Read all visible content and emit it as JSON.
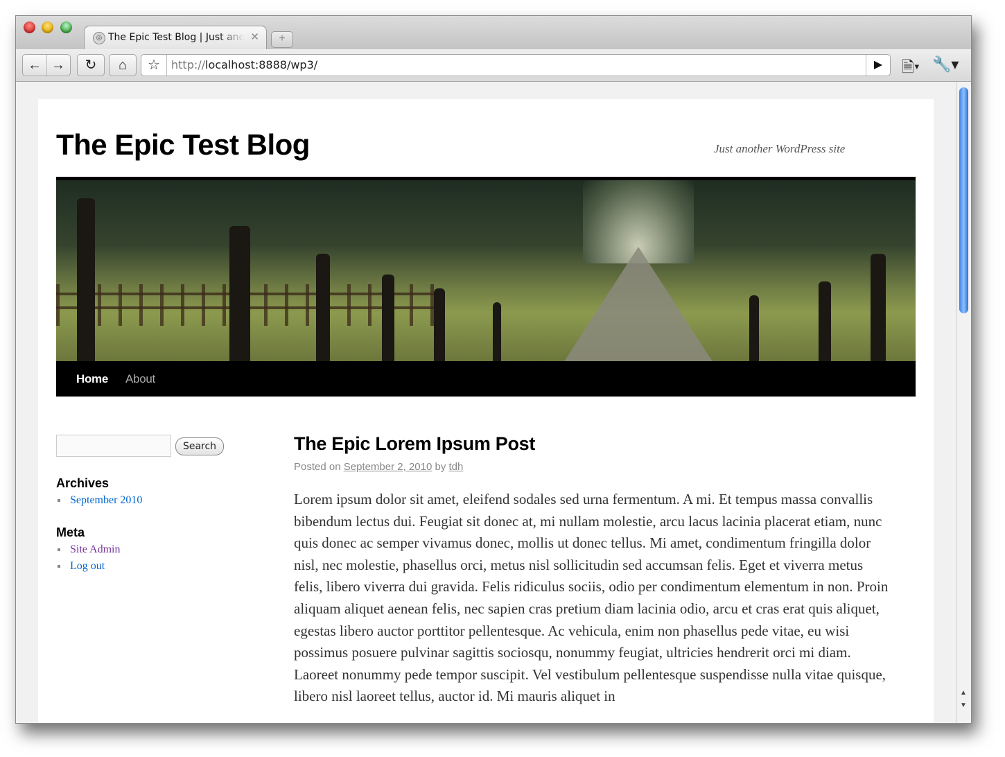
{
  "browser": {
    "tab_title": "The Epic Test Blog | Just another WordPress site",
    "tab_close": "✕",
    "new_tab": "+",
    "url_scheme": "http://",
    "url_rest": "localhost:8888/wp3/",
    "icons": {
      "back": "back-arrow-icon",
      "forward": "forward-arrow-icon",
      "reload": "reload-icon",
      "home": "home-icon",
      "bookmark": "star-icon",
      "go": "play-icon",
      "page": "page-menu-icon",
      "wrench": "wrench-icon"
    }
  },
  "site": {
    "title": "The Epic Test Blog",
    "tagline": "Just another WordPress site"
  },
  "nav": {
    "home": "Home",
    "about": "About"
  },
  "sidebar": {
    "search_button": "Search",
    "search_value": "",
    "archives_title": "Archives",
    "archives": [
      "September 2010"
    ],
    "meta_title": "Meta",
    "meta": [
      "Site Admin",
      "Log out"
    ]
  },
  "post": {
    "title": "The Epic Lorem Ipsum Post",
    "posted_on": "Posted on",
    "date": "September 2, 2010",
    "by": "by",
    "author": "tdh",
    "body": "Lorem ipsum dolor sit amet, eleifend sodales sed urna fermentum. A mi. Et tempus massa convallis bibendum lectus dui. Feugiat sit donec at, mi nullam molestie, arcu lacus lacinia placerat etiam, nunc quis donec ac semper vivamus donec, mollis ut donec tellus. Mi amet, condimentum fringilla dolor nisl, nec molestie, phasellus orci, metus nisl sollicitudin sed accumsan felis. Eget et viverra metus felis, libero viverra dui gravida. Felis ridiculus sociis, odio per condimentum elementum in non. Proin aliquam aliquet aenean felis, nec sapien cras pretium diam lacinia odio, arcu et cras erat quis aliquet, egestas libero auctor porttitor pellentesque. Ac vehicula, enim non phasellus pede vitae, eu wisi possimus posuere pulvinar sagittis sociosqu, nonummy feugiat, ultricies hendrerit orci mi diam. Laoreet nonummy pede tempor suscipit. Vel vestibulum pellentesque suspendisse nulla vitae quisque, libero nisl laoreet tellus, auctor id. Mi mauris aliquet in"
  },
  "colors": {
    "link": "#0066cc",
    "visited_link": "#743399",
    "nav_bg": "#000000",
    "scroll_thumb": "#3a80e0"
  }
}
